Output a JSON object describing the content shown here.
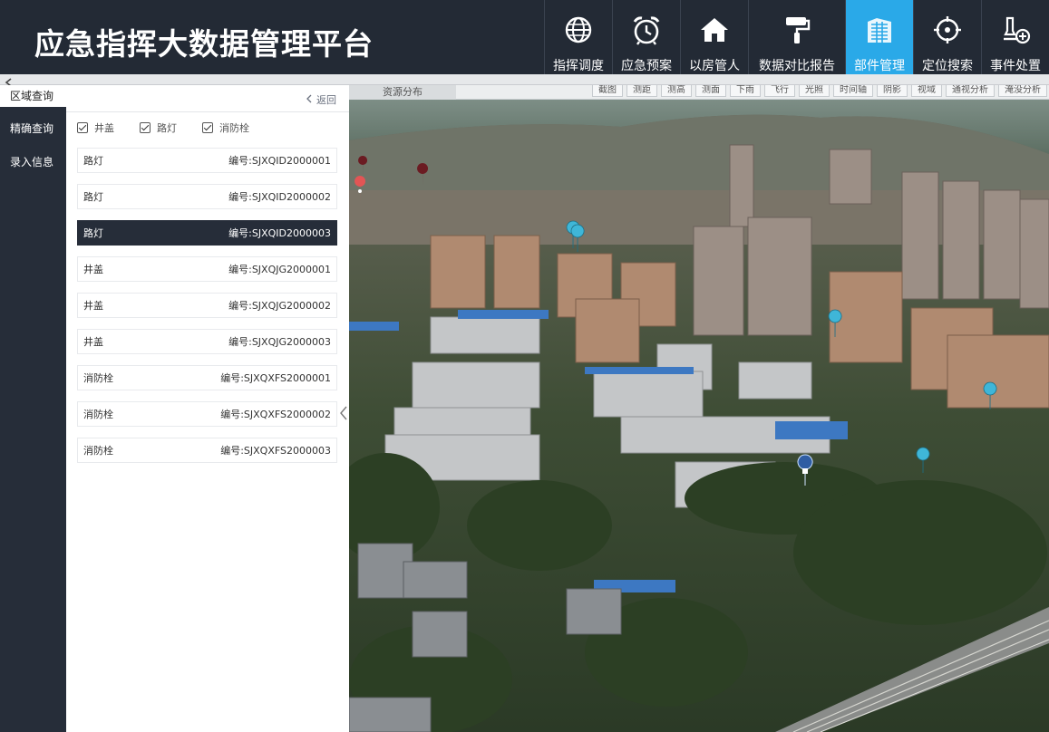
{
  "app": {
    "title": "应急指挥大数据管理平台"
  },
  "nav": [
    {
      "label": "指挥调度",
      "icon": "globe-icon"
    },
    {
      "label": "应急预案",
      "icon": "alarm-clock-icon"
    },
    {
      "label": "以房管人",
      "icon": "home-icon"
    },
    {
      "label": "数据对比报告",
      "icon": "paint-roller-icon"
    },
    {
      "label": "部件管理",
      "icon": "building-icon",
      "active": true
    },
    {
      "label": "定位搜索",
      "icon": "target-icon"
    },
    {
      "label": "事件处置",
      "icon": "user-add-icon"
    }
  ],
  "left_menu": [
    {
      "label": "区域查询",
      "active": true
    },
    {
      "label": "精确查询"
    },
    {
      "label": "录入信息"
    }
  ],
  "panel": {
    "back_label": "返回",
    "filters": [
      {
        "label": "井盖",
        "checked": true
      },
      {
        "label": "路灯",
        "checked": true
      },
      {
        "label": "消防栓",
        "checked": true
      }
    ],
    "rows": [
      {
        "type": "路灯",
        "code": "编号:SJXQID2000001"
      },
      {
        "type": "路灯",
        "code": "编号:SJXQID2000002"
      },
      {
        "type": "路灯",
        "code": "编号:SJXQID2000003",
        "selected": true
      },
      {
        "type": "井盖",
        "code": "编号:SJXQJG2000001"
      },
      {
        "type": "井盖",
        "code": "编号:SJXQJG2000002"
      },
      {
        "type": "井盖",
        "code": "编号:SJXQJG2000003"
      },
      {
        "type": "消防栓",
        "code": "编号:SJXQXFS2000001"
      },
      {
        "type": "消防栓",
        "code": "编号:SJXQXFS2000002"
      },
      {
        "type": "消防栓",
        "code": "编号:SJXQXFS2000003"
      }
    ]
  },
  "map": {
    "layer_tab": "资源分布",
    "tools": [
      "截图",
      "测距",
      "测高",
      "测面",
      "下雨",
      "飞行",
      "光照",
      "时间轴",
      "阴影",
      "视域",
      "通视分析",
      "淹没分析"
    ]
  },
  "colors": {
    "header_bg": "#232a35",
    "accent": "#2aa9e8",
    "menu_bg": "#262d39",
    "selected_row_bg": "#262d39",
    "marker_blue": "#3fb6d8",
    "marker_red": "#e25555"
  }
}
